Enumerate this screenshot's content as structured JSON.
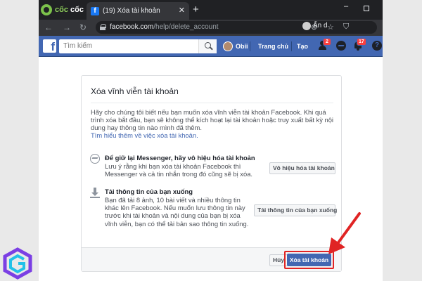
{
  "browser": {
    "brand_prefix": "cốc",
    "brand_suffix": "cốc",
    "tab_title": "(19) Xóa tài khoản",
    "tab_close": "✕",
    "new_tab": "+",
    "window_min": "–",
    "url_host": "facebook.com",
    "url_path": "/help/delete_account",
    "profile_text": "Ẩn d"
  },
  "facebook": {
    "logo": "f",
    "search_placeholder": "Tìm kiếm",
    "user_name": "Obii",
    "nav_home": "Trang chủ",
    "nav_create": "Tạo",
    "friend_requests_badge": "2",
    "notifications_badge": "17",
    "help_glyph": "?"
  },
  "dialog": {
    "title": "Xóa vĩnh viễn tài khoản",
    "intro": "Hãy cho chúng tôi biết nếu bạn muốn xóa vĩnh viễn tài khoản Facebook. Khi quá trình xóa bắt đầu, bạn sẽ không thể kích hoạt lại tài khoản hoặc truy xuất bất kỳ nội dung hay thông tin nào mình đã thêm.",
    "learn_more": "Tìm hiểu thêm về việc xóa tài khoản.",
    "option_messenger": {
      "title": "Để giữ lại Messenger, hãy vô hiệu hóa tài khoản",
      "description": "Lưu ý rằng khi bạn xóa tài khoản Facebook thì Messenger và cả tin nhắn trong đó cũng sẽ bị xóa.",
      "button": "Vô hiệu hóa tài khoản"
    },
    "option_download": {
      "title": "Tải thông tin của bạn xuống",
      "description": "Bạn đã tải 8 ảnh, 10 bài viết và nhiều thông tin khác lên Facebook. Nếu muốn lưu thông tin này trước khi tài khoản và nội dung của bạn bị xóa vĩnh viễn, bạn có thể tải bản sao thông tin xuống.",
      "button": "Tải thông tin của bạn xuống"
    },
    "cancel_button": "Hủy",
    "delete_button": "Xóa tài khoản"
  },
  "colors": {
    "facebook_blue": "#4267b2",
    "highlight_red": "#e02424",
    "browser_dark": "#202124"
  }
}
